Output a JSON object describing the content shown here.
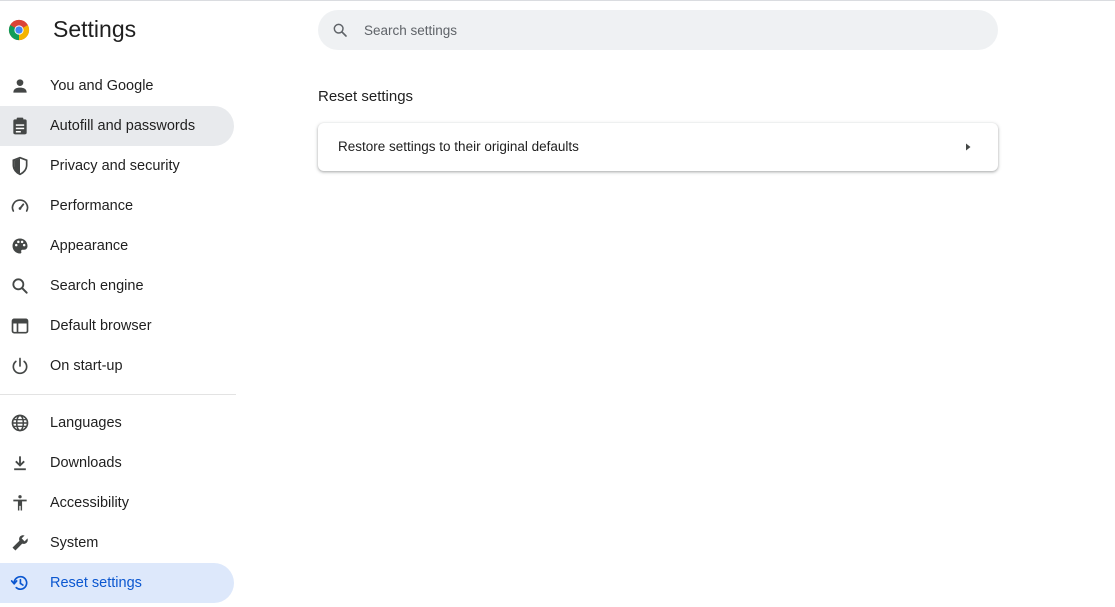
{
  "header": {
    "title": "Settings",
    "logo_icon": "chrome-logo-icon"
  },
  "search": {
    "placeholder": "Search settings",
    "value": "",
    "icon": "search-icon"
  },
  "sidebar": {
    "items": [
      {
        "label": "You and Google",
        "icon": "person-icon",
        "state": "normal"
      },
      {
        "label": "Autofill and passwords",
        "icon": "clipboard-icon",
        "state": "hover"
      },
      {
        "label": "Privacy and security",
        "icon": "shield-icon",
        "state": "normal"
      },
      {
        "label": "Performance",
        "icon": "speedometer-icon",
        "state": "normal"
      },
      {
        "label": "Appearance",
        "icon": "palette-icon",
        "state": "normal"
      },
      {
        "label": "Search engine",
        "icon": "search-icon",
        "state": "normal"
      },
      {
        "label": "Default browser",
        "icon": "browser-window-icon",
        "state": "normal"
      },
      {
        "label": "On start-up",
        "icon": "power-icon",
        "state": "normal"
      },
      {
        "label": "Languages",
        "icon": "globe-icon",
        "state": "normal"
      },
      {
        "label": "Downloads",
        "icon": "download-icon",
        "state": "normal"
      },
      {
        "label": "Accessibility",
        "icon": "accessibility-icon",
        "state": "normal"
      },
      {
        "label": "System",
        "icon": "wrench-icon",
        "state": "normal"
      },
      {
        "label": "Reset settings",
        "icon": "restore-history-icon",
        "state": "active"
      }
    ]
  },
  "main": {
    "section_title": "Reset settings",
    "rows": [
      {
        "label": "Restore settings to their original defaults",
        "icon": "arrow-right-icon"
      }
    ]
  },
  "colors": {
    "accent": "#0b57d0",
    "active_bg": "#dde8fb",
    "hover_bg": "#e8eaed",
    "icon": "#444746",
    "search_bg": "#eff1f3"
  }
}
